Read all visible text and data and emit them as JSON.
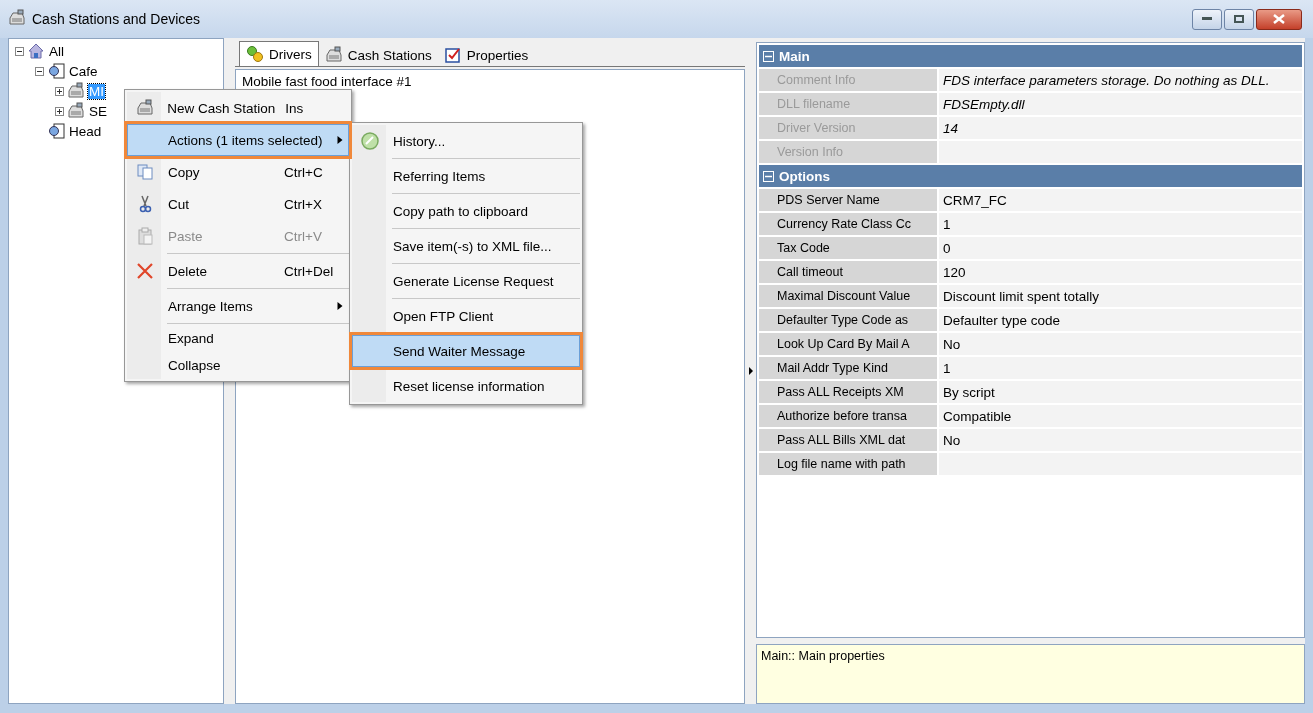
{
  "window": {
    "title": "Cash Stations and Devices"
  },
  "tree": [
    {
      "kind": "root",
      "label": "All",
      "expanded": true,
      "selected": false,
      "children": [
        {
          "kind": "group",
          "label": "Cafe",
          "expanded": true,
          "selected": false,
          "children": [
            {
              "kind": "station",
              "label": "MI",
              "expanded": false,
              "selected": true
            },
            {
              "kind": "station",
              "label": "SE",
              "expanded": false,
              "selected": false
            }
          ]
        },
        {
          "kind": "group",
          "label": "Head",
          "selected": false
        }
      ]
    }
  ],
  "tabs": [
    {
      "label": "Drivers",
      "selected": true
    },
    {
      "label": "Cash Stations",
      "selected": false
    },
    {
      "label": "Properties",
      "selected": false
    }
  ],
  "drivers": [
    "Mobile fast food interface #1"
  ],
  "context_menu": [
    {
      "kind": "item",
      "label": "New Cash Station",
      "shortcut": "Ins",
      "selected": false,
      "disabled": false
    },
    {
      "kind": "submenu",
      "label": "Actions (1 items selected)",
      "selected": true,
      "disabled": false
    },
    {
      "kind": "item",
      "label": "Copy",
      "shortcut": "Ctrl+C",
      "selected": false,
      "disabled": false
    },
    {
      "kind": "item",
      "label": "Cut",
      "shortcut": "Ctrl+X",
      "selected": false,
      "disabled": false
    },
    {
      "kind": "item",
      "label": "Paste",
      "shortcut": "Ctrl+V",
      "selected": false,
      "disabled": true
    },
    {
      "kind": "separator"
    },
    {
      "kind": "item",
      "label": "Delete",
      "shortcut": "Ctrl+Del",
      "selected": false,
      "disabled": false
    },
    {
      "kind": "separator"
    },
    {
      "kind": "submenu",
      "label": "Arrange Items",
      "selected": false,
      "disabled": false
    },
    {
      "kind": "separator"
    },
    {
      "kind": "item",
      "label": "Expand",
      "selected": false,
      "disabled": false
    },
    {
      "kind": "item",
      "label": "Collapse",
      "selected": false,
      "disabled": false
    }
  ],
  "submenu": [
    {
      "label": "History...",
      "selected": false
    },
    {
      "label": "Referring Items",
      "selected": false
    },
    {
      "label": "Copy path to clipboard",
      "selected": false
    },
    {
      "label": "Save item(-s) to XML file...",
      "selected": false
    },
    {
      "label": "Generate License Request",
      "selected": false
    },
    {
      "label": "Open FTP Client",
      "selected": false
    },
    {
      "label": "Send Waiter Message",
      "selected": true
    },
    {
      "label": "Reset license information",
      "selected": false
    }
  ],
  "properties": [
    {
      "kind": "category",
      "label": "Main",
      "expanded": true
    },
    {
      "kind": "row",
      "label": "Comment Info",
      "value": "FDS interface parameters storage. Do nothing as DLL.",
      "disabled": true
    },
    {
      "kind": "row",
      "label": "DLL filename",
      "value": "FDSEmpty.dll",
      "disabled": true
    },
    {
      "kind": "row",
      "label": "Driver Version",
      "value": "14",
      "disabled": true
    },
    {
      "kind": "row",
      "label": "Version Info",
      "disabled": true
    },
    {
      "kind": "category",
      "label": "Options",
      "expanded": true
    },
    {
      "kind": "row",
      "label": "PDS Server Name",
      "value": "CRM7_FC",
      "disabled": false
    },
    {
      "kind": "row",
      "label": "Currency Rate Class Cc",
      "value": "1",
      "disabled": false
    },
    {
      "kind": "row",
      "label": "Tax Code",
      "value": "0",
      "disabled": false
    },
    {
      "kind": "row",
      "label": "Call timeout",
      "value": "120",
      "disabled": false
    },
    {
      "kind": "row",
      "label": "Maximal Discount Value",
      "value": "Discount limit spent totally",
      "disabled": false
    },
    {
      "kind": "row",
      "label": "Defaulter Type Code as",
      "value": "Defaulter type code",
      "disabled": false
    },
    {
      "kind": "row",
      "label": "Look Up Card By Mail A",
      "value": "No",
      "disabled": false
    },
    {
      "kind": "row",
      "label": "Mail Addr Type Kind",
      "value": "1",
      "disabled": false
    },
    {
      "kind": "row",
      "label": "Pass ALL Receipts XM",
      "value": "By script",
      "disabled": false
    },
    {
      "kind": "row",
      "label": "Authorize before transa",
      "value": "Compatible",
      "disabled": false
    },
    {
      "kind": "row",
      "label": "Pass ALL Bills XML dat",
      "value": "No",
      "disabled": false
    },
    {
      "kind": "row",
      "label": "Log file name with path",
      "disabled": false
    }
  ],
  "description": "Main:: Main properties"
}
